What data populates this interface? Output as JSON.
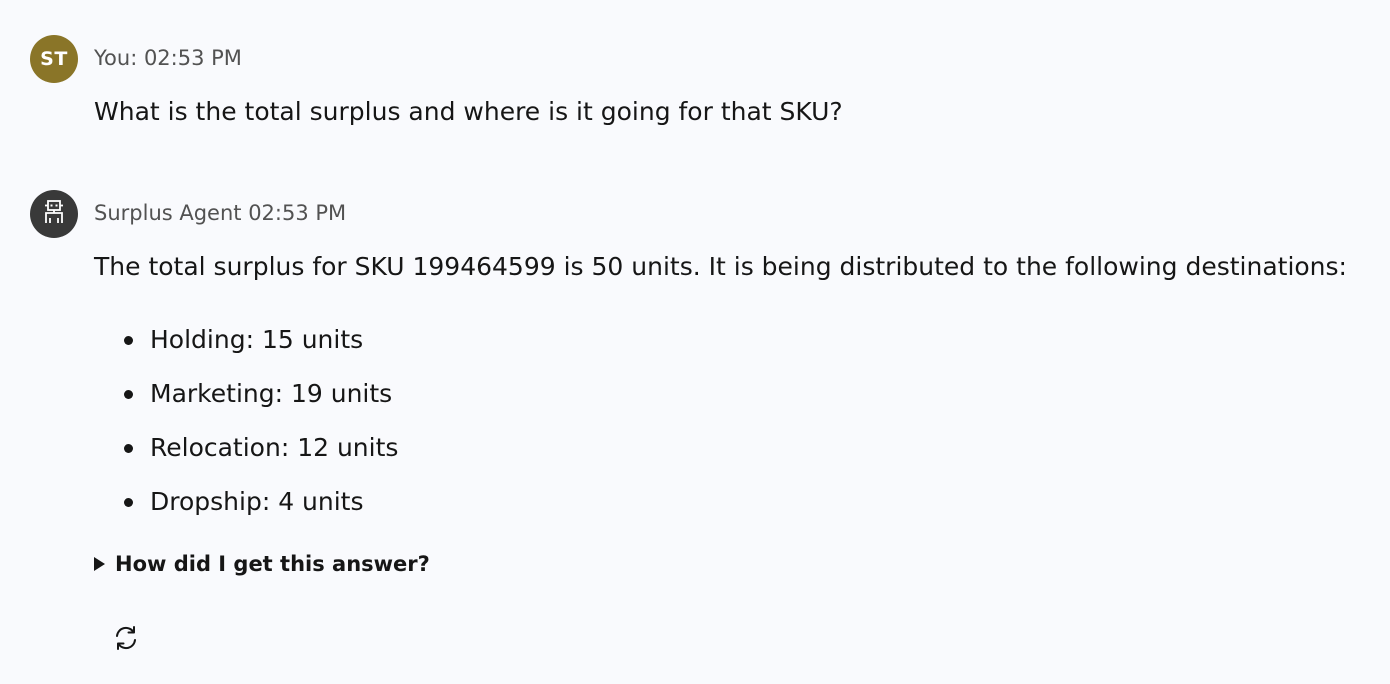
{
  "messages": {
    "user": {
      "avatar_initials": "ST",
      "avatar_color": "#8a7528",
      "sender_time": "You: 02:53 PM",
      "text": "What is the total surplus and where is it going for that SKU?"
    },
    "agent": {
      "avatar_icon": "robot-icon",
      "avatar_color": "#393939",
      "sender_time": "Surplus Agent 02:53 PM",
      "text": "The total surplus for SKU 199464599 is 50 units. It is being distributed to the following destinations:",
      "destinations": [
        {
          "label": "Holding: 15 units"
        },
        {
          "label": "Marketing: 19 units"
        },
        {
          "label": "Relocation: 12 units"
        },
        {
          "label": "Dropship: 4 units"
        }
      ],
      "explain_label": "How did I get this answer?",
      "regenerate_icon": "refresh-icon"
    }
  }
}
